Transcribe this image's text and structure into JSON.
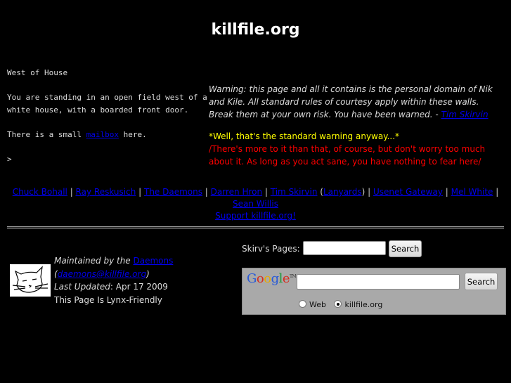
{
  "header": {
    "title": "killfile.org"
  },
  "zork": {
    "room": "West of House",
    "description": "You are standing in an open field west of a white house, with a boarded front door.",
    "mailbox_prefix": "There is a small ",
    "mailbox_link": "mailbox",
    "mailbox_suffix": " here.",
    "prompt": ">"
  },
  "warning": {
    "text": "Warning: this page and all it contains is the personal domain of Nik and Kile. All standard rules of courtesy apply within these walls. Break them at your own risk. You have been warned. - ",
    "author_link": "Tim Skirvin",
    "yellow_note": "*Well, that's the standard warning anyway...*",
    "red_note": "/There's more to it than that, of course, but don't worry too much about it. As long as you act sane, you have nothing to fear here/"
  },
  "links": {
    "items": [
      "Chuck Bohall",
      "Ray Reskusich",
      "The Daemons",
      "Darren Hron",
      "Tim Skirvin",
      "Lanyards",
      "Usenet Gateway",
      "Mel White",
      "Sean Willis"
    ],
    "separator": " | ",
    "open_paren": " (",
    "close_paren": ")",
    "support": "Support killfile.org!"
  },
  "maintainer": {
    "maintained_by": "Maintained by the ",
    "daemons_link": "Daemons",
    "email_link": "daemons@killfile.org",
    "open_paren": "(",
    "close_paren": ")",
    "last_updated_label": "Last Updated",
    "last_updated_value": ": Apr 17 2009",
    "lynx": "This Page Is Lynx-Friendly"
  },
  "skirv_search": {
    "label": "Skirv's Pages:",
    "value": "",
    "button": "Search"
  },
  "google_search": {
    "logo": "Google",
    "logo_tm": "TM",
    "value": "",
    "button": "Search",
    "options": [
      {
        "label": "Web",
        "selected": false
      },
      {
        "label": "killfile.org",
        "selected": true
      }
    ]
  },
  "colors": {
    "link": "#0000ee",
    "yellow": "#ffff00",
    "red": "#ff0000",
    "background": "#000000"
  }
}
